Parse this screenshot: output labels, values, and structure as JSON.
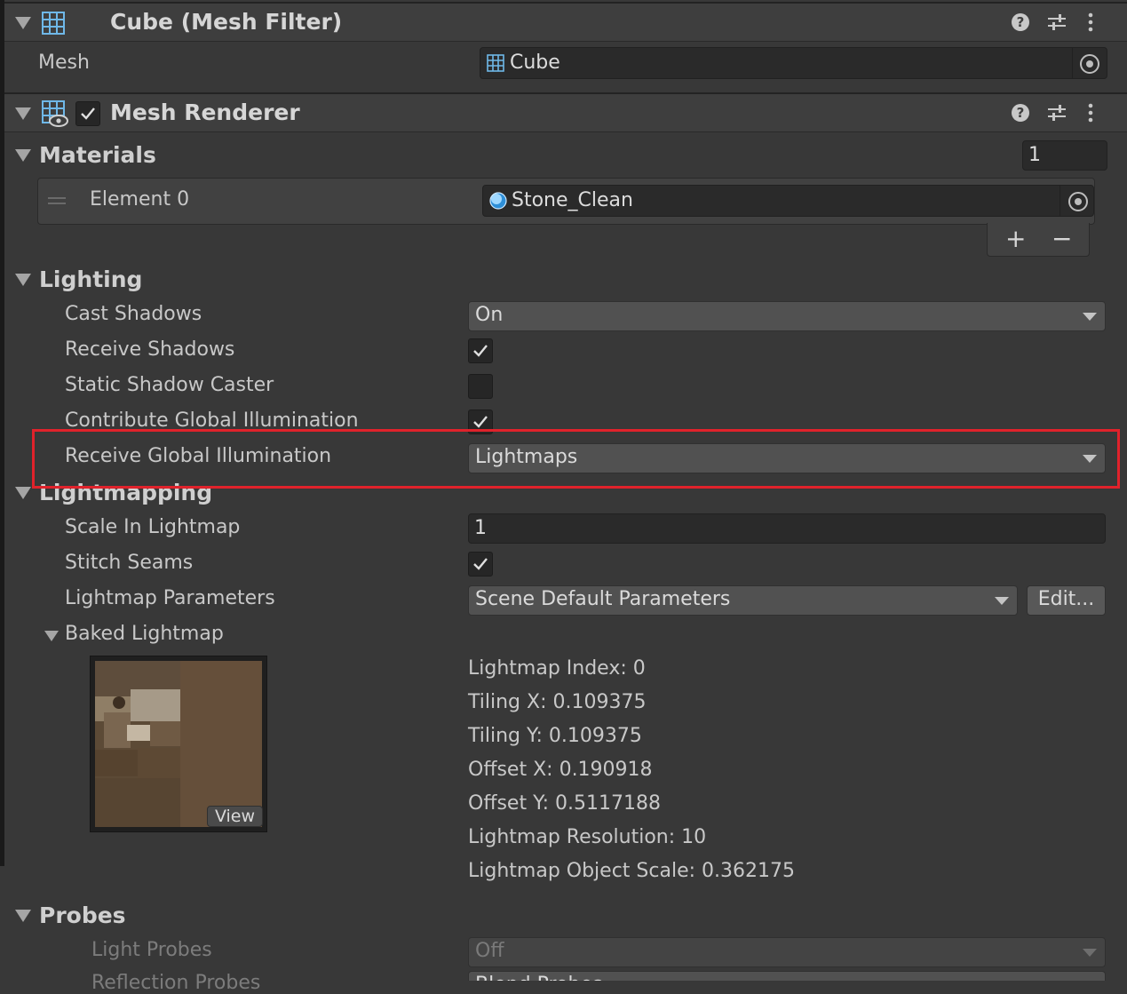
{
  "mesh_filter": {
    "title": "Cube (Mesh Filter)",
    "mesh_label": "Mesh",
    "mesh_value": "Cube"
  },
  "mesh_renderer": {
    "title": "Mesh Renderer",
    "enabled": true
  },
  "materials": {
    "label": "Materials",
    "count": "1",
    "elements": [
      {
        "label": "Element 0",
        "value": "Stone_Clean"
      }
    ],
    "add_symbol": "+",
    "remove_symbol": "−"
  },
  "lighting": {
    "label": "Lighting",
    "cast_shadows_label": "Cast Shadows",
    "cast_shadows_value": "On",
    "receive_shadows_label": "Receive Shadows",
    "receive_shadows": true,
    "static_shadow_caster_label": "Static Shadow Caster",
    "static_shadow_caster": false,
    "contribute_gi_label": "Contribute Global Illumination",
    "contribute_gi": true,
    "receive_gi_label": "Receive Global Illumination",
    "receive_gi_value": "Lightmaps"
  },
  "lightmapping": {
    "label": "Lightmapping",
    "scale_label": "Scale In Lightmap",
    "scale_value": "1",
    "stitch_seams_label": "Stitch Seams",
    "stitch_seams": true,
    "params_label": "Lightmap Parameters",
    "params_value": "Scene Default Parameters",
    "edit_button": "Edit...",
    "baked_label": "Baked Lightmap",
    "view_button": "View",
    "info": [
      "Lightmap Index: 0",
      "Tiling X: 0.109375",
      "Tiling Y: 0.109375",
      "Offset X: 0.190918",
      "Offset Y: 0.5117188",
      "Lightmap Resolution: 10",
      "Lightmap Object Scale: 0.362175"
    ]
  },
  "probes": {
    "label": "Probes",
    "light_probes_label": "Light Probes",
    "light_probes_value": "Off",
    "reflection_probes_label": "Reflection Probes",
    "reflection_probes_value": "Blend Probes"
  },
  "colors": {
    "background": "#383838",
    "highlight": "#e0222b",
    "icon_blue": "#6fb8e8"
  }
}
